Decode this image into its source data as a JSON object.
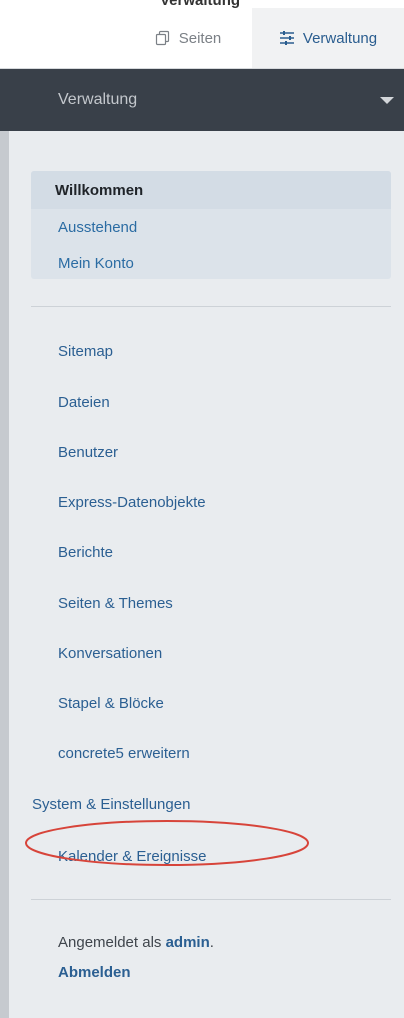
{
  "top_strip_partial_text": "Verwaltung",
  "tabs": {
    "seiten_label": "Seiten",
    "verwaltung_label": "Verwaltung"
  },
  "header": {
    "title": "Verwaltung"
  },
  "welcome": {
    "title": "Willkommen",
    "links": [
      "Ausstehend",
      "Mein Konto"
    ]
  },
  "nav": {
    "items": [
      "Sitemap",
      "Dateien",
      "Benutzer",
      "Express-Datenobjekte",
      "Berichte",
      "Seiten & Themes",
      "Konversationen",
      "Stapel & Blöcke",
      "concrete5 erweitern",
      "System & Einstellungen",
      "Kalender & Ereignisse"
    ]
  },
  "footer": {
    "logged_in_prefix": "Angemeldet als ",
    "username": "admin",
    "logged_in_suffix": ".",
    "logout_label": "Abmelden"
  },
  "colors": {
    "header_bg": "#394049",
    "link": "#2b5f92",
    "highlight_ring": "#d7443a"
  }
}
